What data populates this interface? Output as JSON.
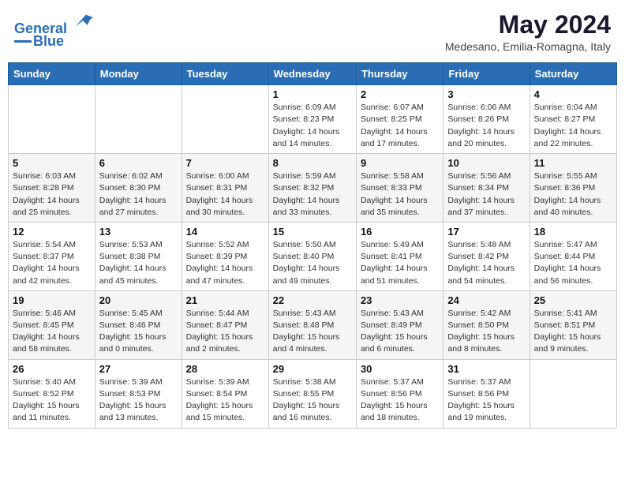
{
  "header": {
    "logo_line1": "General",
    "logo_line2": "Blue",
    "month": "May 2024",
    "location": "Medesano, Emilia-Romagna, Italy"
  },
  "days_of_week": [
    "Sunday",
    "Monday",
    "Tuesday",
    "Wednesday",
    "Thursday",
    "Friday",
    "Saturday"
  ],
  "weeks": [
    [
      {
        "day": "",
        "info": ""
      },
      {
        "day": "",
        "info": ""
      },
      {
        "day": "",
        "info": ""
      },
      {
        "day": "1",
        "info": "Sunrise: 6:09 AM\nSunset: 8:23 PM\nDaylight: 14 hours\nand 14 minutes."
      },
      {
        "day": "2",
        "info": "Sunrise: 6:07 AM\nSunset: 8:25 PM\nDaylight: 14 hours\nand 17 minutes."
      },
      {
        "day": "3",
        "info": "Sunrise: 6:06 AM\nSunset: 8:26 PM\nDaylight: 14 hours\nand 20 minutes."
      },
      {
        "day": "4",
        "info": "Sunrise: 6:04 AM\nSunset: 8:27 PM\nDaylight: 14 hours\nand 22 minutes."
      }
    ],
    [
      {
        "day": "5",
        "info": "Sunrise: 6:03 AM\nSunset: 8:28 PM\nDaylight: 14 hours\nand 25 minutes."
      },
      {
        "day": "6",
        "info": "Sunrise: 6:02 AM\nSunset: 8:30 PM\nDaylight: 14 hours\nand 27 minutes."
      },
      {
        "day": "7",
        "info": "Sunrise: 6:00 AM\nSunset: 8:31 PM\nDaylight: 14 hours\nand 30 minutes."
      },
      {
        "day": "8",
        "info": "Sunrise: 5:59 AM\nSunset: 8:32 PM\nDaylight: 14 hours\nand 33 minutes."
      },
      {
        "day": "9",
        "info": "Sunrise: 5:58 AM\nSunset: 8:33 PM\nDaylight: 14 hours\nand 35 minutes."
      },
      {
        "day": "10",
        "info": "Sunrise: 5:56 AM\nSunset: 8:34 PM\nDaylight: 14 hours\nand 37 minutes."
      },
      {
        "day": "11",
        "info": "Sunrise: 5:55 AM\nSunset: 8:36 PM\nDaylight: 14 hours\nand 40 minutes."
      }
    ],
    [
      {
        "day": "12",
        "info": "Sunrise: 5:54 AM\nSunset: 8:37 PM\nDaylight: 14 hours\nand 42 minutes."
      },
      {
        "day": "13",
        "info": "Sunrise: 5:53 AM\nSunset: 8:38 PM\nDaylight: 14 hours\nand 45 minutes."
      },
      {
        "day": "14",
        "info": "Sunrise: 5:52 AM\nSunset: 8:39 PM\nDaylight: 14 hours\nand 47 minutes."
      },
      {
        "day": "15",
        "info": "Sunrise: 5:50 AM\nSunset: 8:40 PM\nDaylight: 14 hours\nand 49 minutes."
      },
      {
        "day": "16",
        "info": "Sunrise: 5:49 AM\nSunset: 8:41 PM\nDaylight: 14 hours\nand 51 minutes."
      },
      {
        "day": "17",
        "info": "Sunrise: 5:48 AM\nSunset: 8:42 PM\nDaylight: 14 hours\nand 54 minutes."
      },
      {
        "day": "18",
        "info": "Sunrise: 5:47 AM\nSunset: 8:44 PM\nDaylight: 14 hours\nand 56 minutes."
      }
    ],
    [
      {
        "day": "19",
        "info": "Sunrise: 5:46 AM\nSunset: 8:45 PM\nDaylight: 14 hours\nand 58 minutes."
      },
      {
        "day": "20",
        "info": "Sunrise: 5:45 AM\nSunset: 8:46 PM\nDaylight: 15 hours\nand 0 minutes."
      },
      {
        "day": "21",
        "info": "Sunrise: 5:44 AM\nSunset: 8:47 PM\nDaylight: 15 hours\nand 2 minutes."
      },
      {
        "day": "22",
        "info": "Sunrise: 5:43 AM\nSunset: 8:48 PM\nDaylight: 15 hours\nand 4 minutes."
      },
      {
        "day": "23",
        "info": "Sunrise: 5:43 AM\nSunset: 8:49 PM\nDaylight: 15 hours\nand 6 minutes."
      },
      {
        "day": "24",
        "info": "Sunrise: 5:42 AM\nSunset: 8:50 PM\nDaylight: 15 hours\nand 8 minutes."
      },
      {
        "day": "25",
        "info": "Sunrise: 5:41 AM\nSunset: 8:51 PM\nDaylight: 15 hours\nand 9 minutes."
      }
    ],
    [
      {
        "day": "26",
        "info": "Sunrise: 5:40 AM\nSunset: 8:52 PM\nDaylight: 15 hours\nand 11 minutes."
      },
      {
        "day": "27",
        "info": "Sunrise: 5:39 AM\nSunset: 8:53 PM\nDaylight: 15 hours\nand 13 minutes."
      },
      {
        "day": "28",
        "info": "Sunrise: 5:39 AM\nSunset: 8:54 PM\nDaylight: 15 hours\nand 15 minutes."
      },
      {
        "day": "29",
        "info": "Sunrise: 5:38 AM\nSunset: 8:55 PM\nDaylight: 15 hours\nand 16 minutes."
      },
      {
        "day": "30",
        "info": "Sunrise: 5:37 AM\nSunset: 8:56 PM\nDaylight: 15 hours\nand 18 minutes."
      },
      {
        "day": "31",
        "info": "Sunrise: 5:37 AM\nSunset: 8:56 PM\nDaylight: 15 hours\nand 19 minutes."
      },
      {
        "day": "",
        "info": ""
      }
    ]
  ]
}
